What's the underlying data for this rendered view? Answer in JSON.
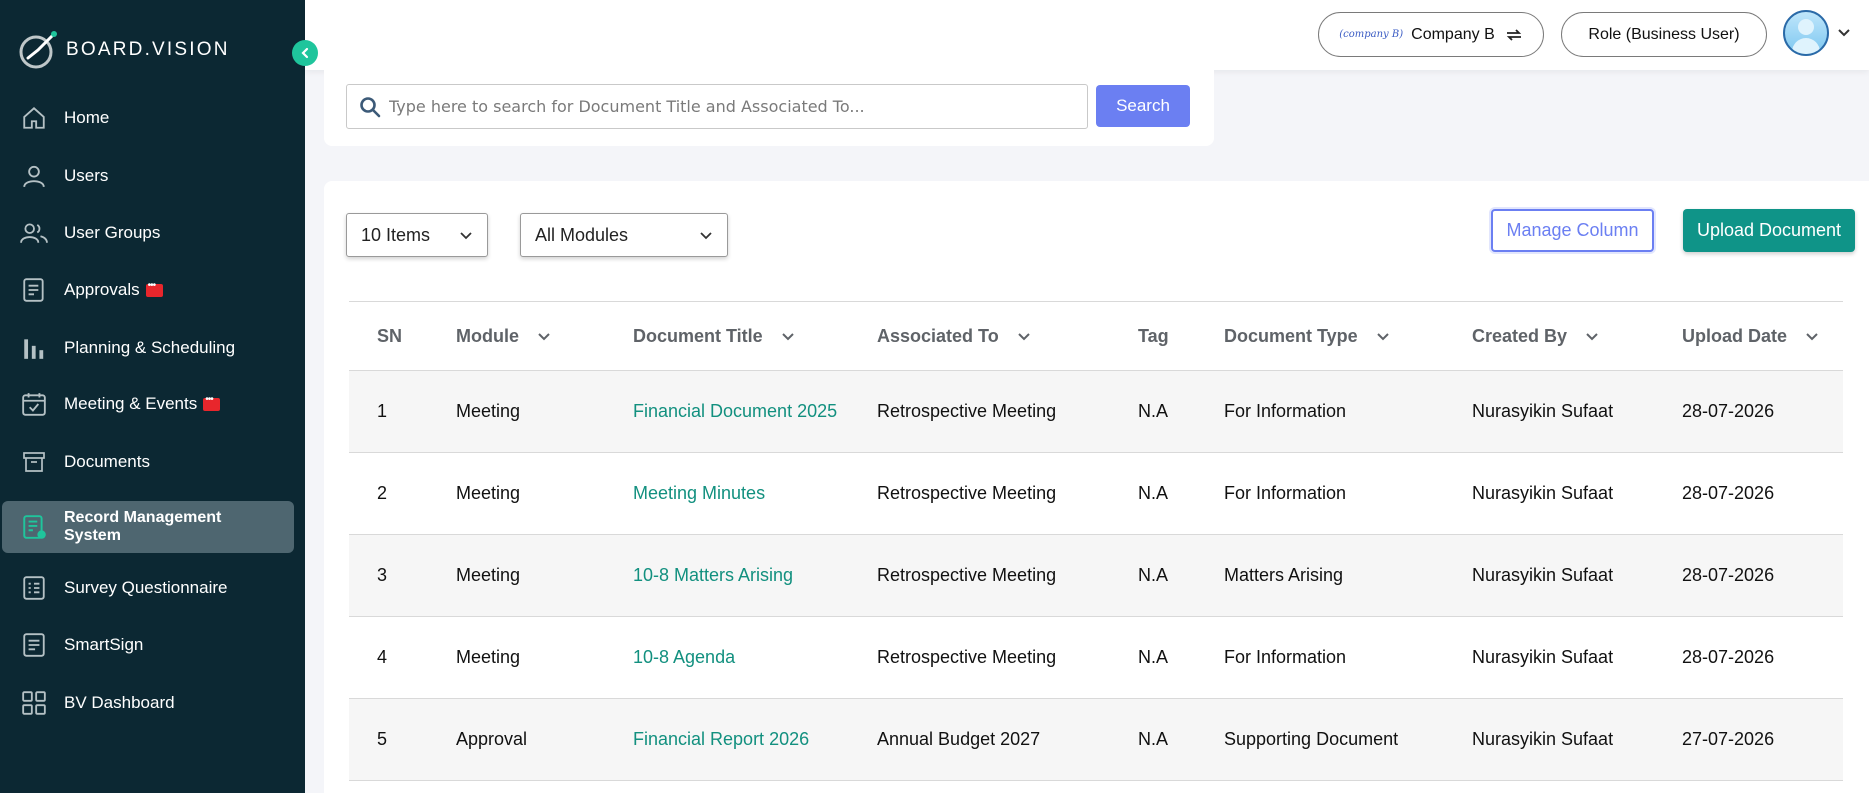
{
  "brand": {
    "name": "BOARD.VISION"
  },
  "sidebar": {
    "items": [
      {
        "label": "Home",
        "icon": "home-icon"
      },
      {
        "label": "Users",
        "icon": "user-icon"
      },
      {
        "label": "User Groups",
        "icon": "users-icon"
      },
      {
        "label": "Approvals",
        "icon": "approvals-icon",
        "badge": true
      },
      {
        "label": "Planning & Scheduling",
        "icon": "bar-chart-icon"
      },
      {
        "label": "Meeting & Events",
        "icon": "calendar-icon",
        "badge": true
      },
      {
        "label": "Documents",
        "icon": "archive-icon"
      },
      {
        "label": "Record Management System",
        "icon": "record-icon",
        "active": true
      },
      {
        "label": "Survey Questionnaire",
        "icon": "survey-icon"
      },
      {
        "label": "SmartSign",
        "icon": "smartsign-icon"
      },
      {
        "label": "BV Dashboard",
        "icon": "dashboard-icon"
      }
    ]
  },
  "header": {
    "company_logo_text": "(company B)",
    "company": "Company B",
    "role": "Role (Business User)"
  },
  "search": {
    "placeholder": "Type here to search for Document Title and Associated To...",
    "button": "Search"
  },
  "controls": {
    "items_select": "10 Items",
    "modules_select": "All Modules",
    "manage_column": "Manage Column",
    "upload_document": "Upload Document"
  },
  "table": {
    "columns": [
      "SN",
      "Module",
      "Document Title",
      "Associated To",
      "Tag",
      "Document Type",
      "Created By",
      "Upload Date"
    ],
    "rows": [
      {
        "sn": "1",
        "module": "Meeting",
        "title": "Financial Document 2025",
        "associated": "Retrospective Meeting",
        "tag": "N.A",
        "type": "For Information",
        "created_by": "Nurasyikin Sufaat",
        "date": "28-07-2026"
      },
      {
        "sn": "2",
        "module": "Meeting",
        "title": "Meeting Minutes",
        "associated": "Retrospective Meeting",
        "tag": "N.A",
        "type": "For Information",
        "created_by": "Nurasyikin Sufaat",
        "date": "28-07-2026"
      },
      {
        "sn": "3",
        "module": "Meeting",
        "title": "10-8 Matters Arising",
        "associated": "Retrospective Meeting",
        "tag": "N.A",
        "type": "Matters Arising",
        "created_by": "Nurasyikin Sufaat",
        "date": "28-07-2026"
      },
      {
        "sn": "4",
        "module": "Meeting",
        "title": "10-8 Agenda",
        "associated": "Retrospective Meeting",
        "tag": "N.A",
        "type": "For Information",
        "created_by": "Nurasyikin Sufaat",
        "date": "28-07-2026"
      },
      {
        "sn": "5",
        "module": "Approval",
        "title": "Financial Report 2026",
        "associated": "Annual Budget 2027",
        "tag": "N.A",
        "type": "Supporting Document",
        "created_by": "Nurasyikin Sufaat",
        "date": "27-07-2026"
      }
    ]
  },
  "colors": {
    "sidebar": "#0c2833",
    "accent": "#6b7ff2",
    "teal": "#0f9488",
    "link": "#12907f",
    "badge": "#e8262c"
  }
}
